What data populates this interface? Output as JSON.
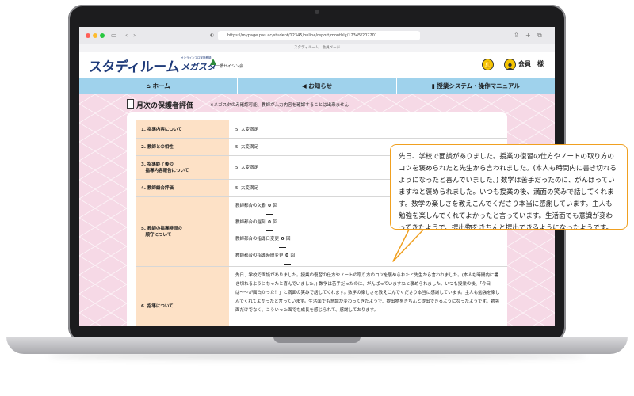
{
  "browser": {
    "url": "https://mypage.pas.ac/student/12345/online/report/monthly/12345/202201",
    "tab_title": "スタディルーム　会員ページ"
  },
  "header": {
    "logo": "スタディルーム",
    "megasta": "メガスタ",
    "megasta_sub": "オンラインプロ家庭教師",
    "partner": "一橋セイシン会",
    "user_label": "会員　様"
  },
  "nav": {
    "items": [
      {
        "label": "ホーム",
        "icon": "home-icon"
      },
      {
        "label": "お知らせ",
        "icon": "megaphone-icon"
      },
      {
        "label": "授業システム・操作マニュアル",
        "icon": "book-icon"
      }
    ]
  },
  "page": {
    "title": "月次の保護者評価",
    "note": "※メガスタのみ確認可能、教師が入力内容を確認することは出来ません"
  },
  "evaluation": {
    "rows": [
      {
        "question": "1. 指導内容について",
        "answer": "5. 大変満足"
      },
      {
        "question": "2. 教師との相性",
        "answer": "5. 大変満足"
      },
      {
        "question": "3. 指導終了後の\n　指導内容報告について",
        "answer": "5. 大変満足"
      },
      {
        "question": "4. 教師総合評価",
        "answer": "5. 大変満足"
      }
    ],
    "row5": {
      "question": "5. 教師の指導時間の\n　順守について",
      "items": [
        {
          "label": "教師都合の欠勤",
          "value": "0",
          "unit": "回"
        },
        {
          "label": "教師都合の遅刻",
          "value": "0",
          "unit": "回"
        },
        {
          "label": "教師都合の指導日変更",
          "value": "0",
          "unit": "回"
        },
        {
          "label": "教師都合の指導時間変更",
          "value": "0",
          "unit": "回"
        }
      ]
    },
    "row6": {
      "question": "6. 指導について",
      "answer": "先日、学校で面談がありました。授業の復習の仕方やノートの取り方のコツを褒められたと先生から言われました。(本人も時間内に書き切れるようになったと喜んでいました。) 数学は苦手だったのに、がんばっていますねと褒められました。いつも授業の後、「今日は〜〜が面白かった！」と満面の笑みで話してくれます。数学の楽しさを教えこんでくださり本当に感謝しています。主人も勉強を楽しんでくれてよかったと言っています。生活面でも意識が変わってきたようで、提出物をきちんと提出できるようになったようです。勉強面だけでなく、こういった面でも成長を感じられて、感謝しております。"
    }
  },
  "bubble": {
    "text": "先日、学校で面談がありました。授業の復習の仕方やノートの取り方のコツを褒められたと先生から言われました。(本人も時間内に書き切れるようになったと喜んでいました。) 数学は苦手だったのに、がんばっていますねと褒められました。いつも授業の後、満面の笑みで話してくれます。数学の楽しさを教えこんでくださり本当に感謝しています。主人も勉強を楽しんでくれてよかったと言っています。生活面でも意識が変わってきたようで、提出物をきちんと提出できるようになったようです。勉強面だけでなく、こういった面でも成長を感じられています。"
  },
  "colors": {
    "brand": "#1f3b7a",
    "nav": "#9fd2ec",
    "question_bg": "#fde1c6",
    "page_bg": "#f6d9e6",
    "bubble_border": "#f0a020"
  }
}
